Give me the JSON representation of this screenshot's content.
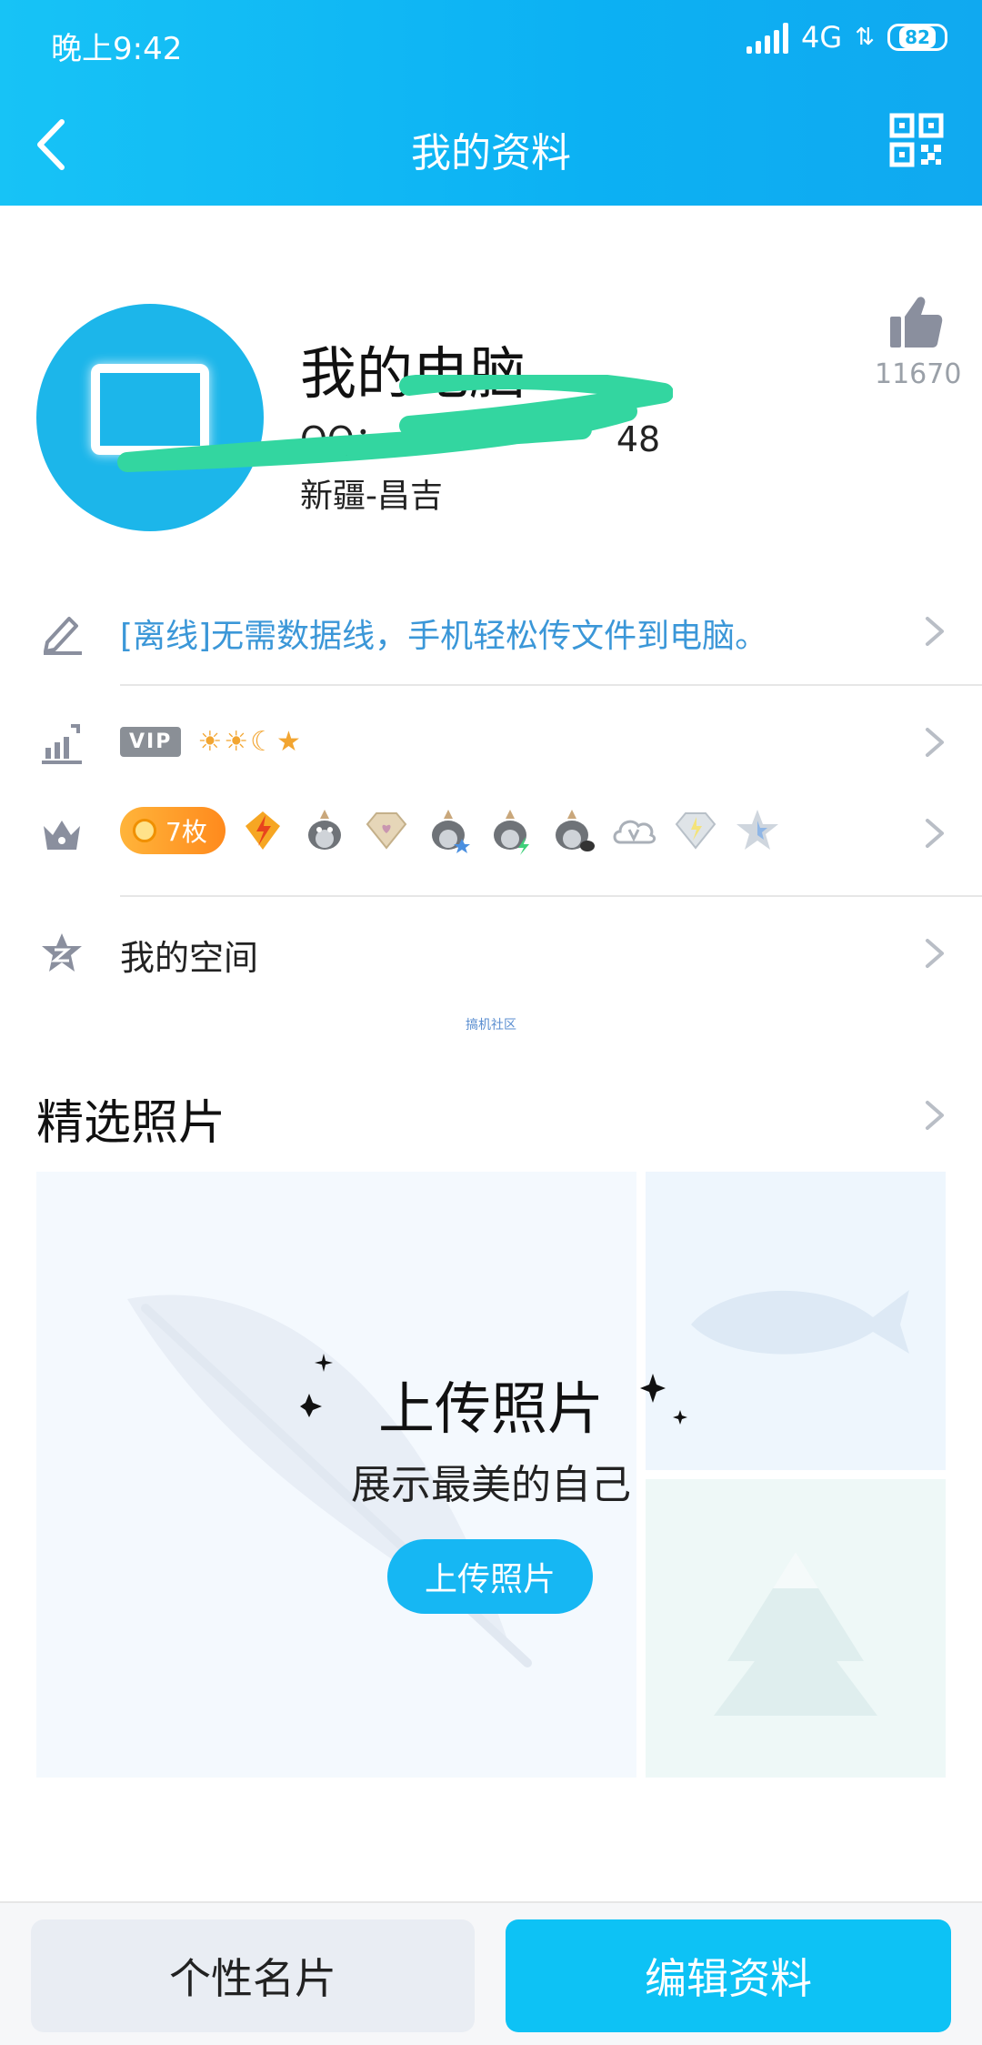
{
  "status_bar": {
    "time": "晚上9:42",
    "network": "4G",
    "network_arrows": "⇅",
    "battery": "82"
  },
  "nav": {
    "title": "我的资料",
    "back_icon": "chevron-left-icon",
    "qr_icon": "qr-code-icon"
  },
  "profile": {
    "name": "我的电脑",
    "qq_label": "QQ：",
    "qq_number_visible_tail": "48",
    "location": "新疆-昌吉",
    "like_count": "11670"
  },
  "rows": {
    "signature": "[离线]无需数据线，手机轻松传文件到电脑。",
    "vip_badge": "VIP",
    "level_icons": "☀☀☾★",
    "medal_count": "7枚",
    "space": "我的空间"
  },
  "watermark": "搞机社区",
  "photos": {
    "title": "精选照片",
    "upload_heading": "上传照片",
    "upload_subtitle": "展示最美的自己",
    "upload_button": "上传照片"
  },
  "bottom": {
    "card_button": "个性名片",
    "edit_button": "编辑资料"
  },
  "colors": {
    "header": "#0cb1f3",
    "accent": "#16b7f3",
    "signature_text": "#3b97d8",
    "icon_gray": "#8a8f9e"
  }
}
